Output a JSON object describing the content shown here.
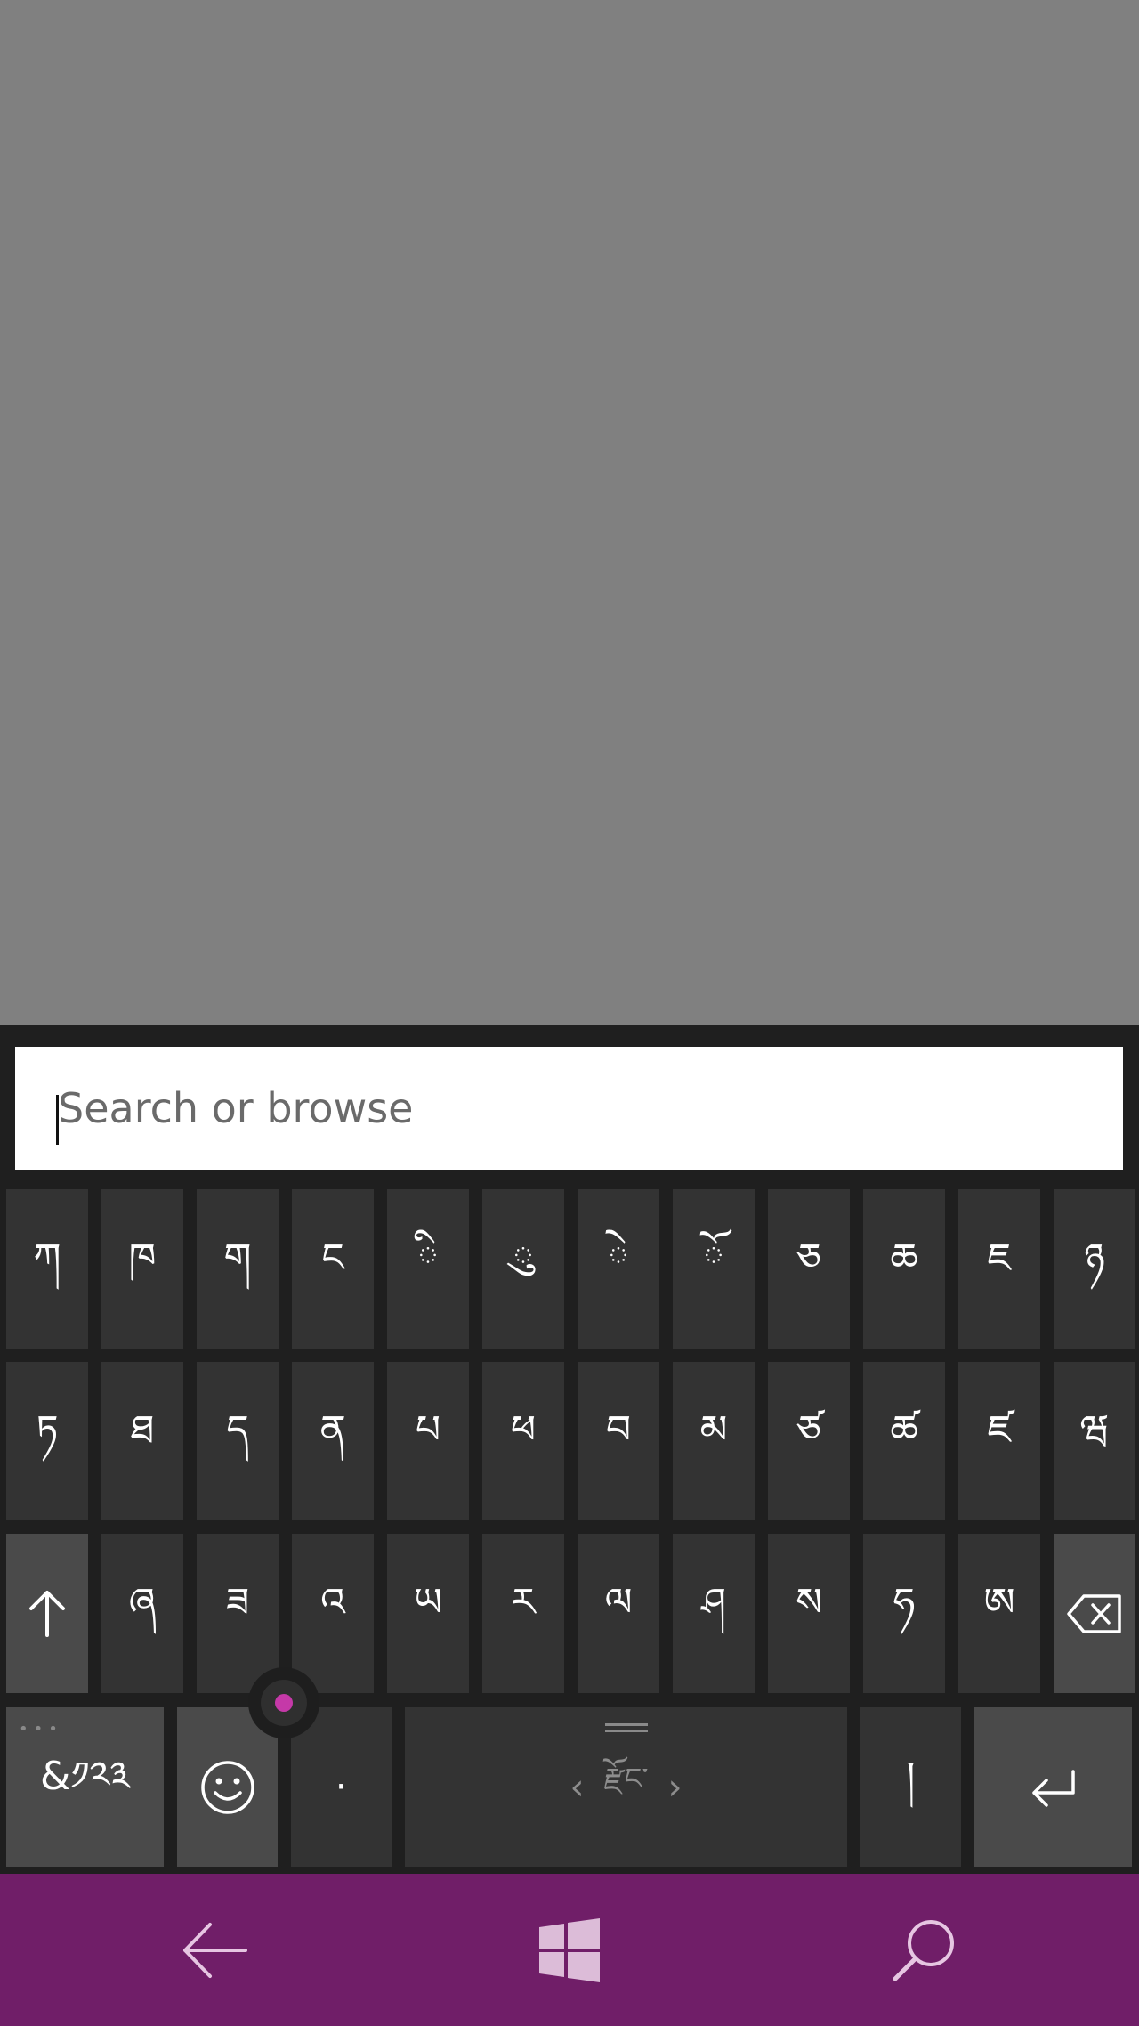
{
  "search": {
    "placeholder": "Search or browse",
    "value": ""
  },
  "keyboard": {
    "row1": [
      "ཀ",
      "ཁ",
      "ག",
      "ང",
      "ི",
      "ུ",
      "ེ",
      "ོ",
      "ཅ",
      "ཆ",
      "ཇ",
      "ཉ"
    ],
    "row2": [
      "ཏ",
      "ཐ",
      "ད",
      "ན",
      "པ",
      "ཕ",
      "བ",
      "མ",
      "ཙ",
      "ཚ",
      "ཛ",
      "ཝ"
    ],
    "row3": [
      "ཞ",
      "ཟ",
      "འ",
      "ཡ",
      "ར",
      "ལ",
      "ཤ",
      "ས",
      "ཧ",
      "ཨ"
    ],
    "symbols_label": "&༡༢༣",
    "period_label": "·",
    "shad_label": "།",
    "language_label": "རྫོང་"
  },
  "icons": {
    "shift": "up-arrow-icon",
    "backspace": "backspace-icon",
    "emoji": "smiley-icon",
    "enter": "enter-icon",
    "back": "back-arrow-icon",
    "start": "windows-logo-icon",
    "search": "search-icon"
  },
  "colors": {
    "app_background": "#808080",
    "keyboard_background": "#1f1f1f",
    "key": "#333333",
    "function_key": "#4a4a4a",
    "nav_bar": "#701e68",
    "cursor_dot": "#c539a8"
  }
}
